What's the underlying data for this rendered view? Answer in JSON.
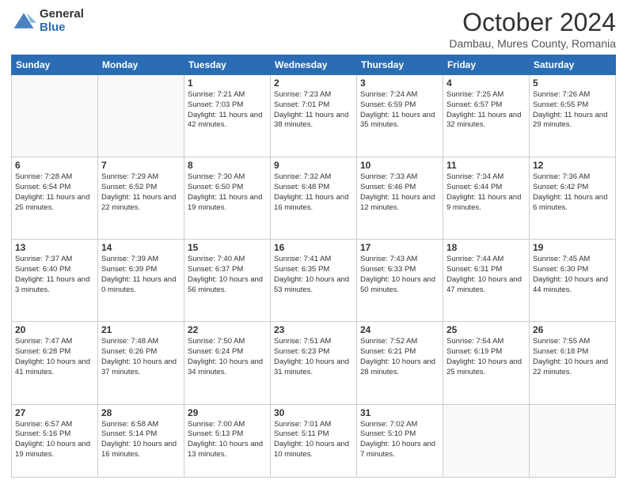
{
  "header": {
    "logo_general": "General",
    "logo_blue": "Blue",
    "month_title": "October 2024",
    "location": "Dambau, Mures County, Romania"
  },
  "weekdays": [
    "Sunday",
    "Monday",
    "Tuesday",
    "Wednesday",
    "Thursday",
    "Friday",
    "Saturday"
  ],
  "weeks": [
    [
      {
        "day": "",
        "sunrise": "",
        "sunset": "",
        "daylight": ""
      },
      {
        "day": "",
        "sunrise": "",
        "sunset": "",
        "daylight": ""
      },
      {
        "day": "1",
        "sunrise": "Sunrise: 7:21 AM",
        "sunset": "Sunset: 7:03 PM",
        "daylight": "Daylight: 11 hours and 42 minutes."
      },
      {
        "day": "2",
        "sunrise": "Sunrise: 7:23 AM",
        "sunset": "Sunset: 7:01 PM",
        "daylight": "Daylight: 11 hours and 38 minutes."
      },
      {
        "day": "3",
        "sunrise": "Sunrise: 7:24 AM",
        "sunset": "Sunset: 6:59 PM",
        "daylight": "Daylight: 11 hours and 35 minutes."
      },
      {
        "day": "4",
        "sunrise": "Sunrise: 7:25 AM",
        "sunset": "Sunset: 6:57 PM",
        "daylight": "Daylight: 11 hours and 32 minutes."
      },
      {
        "day": "5",
        "sunrise": "Sunrise: 7:26 AM",
        "sunset": "Sunset: 6:55 PM",
        "daylight": "Daylight: 11 hours and 29 minutes."
      }
    ],
    [
      {
        "day": "6",
        "sunrise": "Sunrise: 7:28 AM",
        "sunset": "Sunset: 6:54 PM",
        "daylight": "Daylight: 11 hours and 25 minutes."
      },
      {
        "day": "7",
        "sunrise": "Sunrise: 7:29 AM",
        "sunset": "Sunset: 6:52 PM",
        "daylight": "Daylight: 11 hours and 22 minutes."
      },
      {
        "day": "8",
        "sunrise": "Sunrise: 7:30 AM",
        "sunset": "Sunset: 6:50 PM",
        "daylight": "Daylight: 11 hours and 19 minutes."
      },
      {
        "day": "9",
        "sunrise": "Sunrise: 7:32 AM",
        "sunset": "Sunset: 6:48 PM",
        "daylight": "Daylight: 11 hours and 16 minutes."
      },
      {
        "day": "10",
        "sunrise": "Sunrise: 7:33 AM",
        "sunset": "Sunset: 6:46 PM",
        "daylight": "Daylight: 11 hours and 12 minutes."
      },
      {
        "day": "11",
        "sunrise": "Sunrise: 7:34 AM",
        "sunset": "Sunset: 6:44 PM",
        "daylight": "Daylight: 11 hours and 9 minutes."
      },
      {
        "day": "12",
        "sunrise": "Sunrise: 7:36 AM",
        "sunset": "Sunset: 6:42 PM",
        "daylight": "Daylight: 11 hours and 6 minutes."
      }
    ],
    [
      {
        "day": "13",
        "sunrise": "Sunrise: 7:37 AM",
        "sunset": "Sunset: 6:40 PM",
        "daylight": "Daylight: 11 hours and 3 minutes."
      },
      {
        "day": "14",
        "sunrise": "Sunrise: 7:39 AM",
        "sunset": "Sunset: 6:39 PM",
        "daylight": "Daylight: 11 hours and 0 minutes."
      },
      {
        "day": "15",
        "sunrise": "Sunrise: 7:40 AM",
        "sunset": "Sunset: 6:37 PM",
        "daylight": "Daylight: 10 hours and 56 minutes."
      },
      {
        "day": "16",
        "sunrise": "Sunrise: 7:41 AM",
        "sunset": "Sunset: 6:35 PM",
        "daylight": "Daylight: 10 hours and 53 minutes."
      },
      {
        "day": "17",
        "sunrise": "Sunrise: 7:43 AM",
        "sunset": "Sunset: 6:33 PM",
        "daylight": "Daylight: 10 hours and 50 minutes."
      },
      {
        "day": "18",
        "sunrise": "Sunrise: 7:44 AM",
        "sunset": "Sunset: 6:31 PM",
        "daylight": "Daylight: 10 hours and 47 minutes."
      },
      {
        "day": "19",
        "sunrise": "Sunrise: 7:45 AM",
        "sunset": "Sunset: 6:30 PM",
        "daylight": "Daylight: 10 hours and 44 minutes."
      }
    ],
    [
      {
        "day": "20",
        "sunrise": "Sunrise: 7:47 AM",
        "sunset": "Sunset: 6:28 PM",
        "daylight": "Daylight: 10 hours and 41 minutes."
      },
      {
        "day": "21",
        "sunrise": "Sunrise: 7:48 AM",
        "sunset": "Sunset: 6:26 PM",
        "daylight": "Daylight: 10 hours and 37 minutes."
      },
      {
        "day": "22",
        "sunrise": "Sunrise: 7:50 AM",
        "sunset": "Sunset: 6:24 PM",
        "daylight": "Daylight: 10 hours and 34 minutes."
      },
      {
        "day": "23",
        "sunrise": "Sunrise: 7:51 AM",
        "sunset": "Sunset: 6:23 PM",
        "daylight": "Daylight: 10 hours and 31 minutes."
      },
      {
        "day": "24",
        "sunrise": "Sunrise: 7:52 AM",
        "sunset": "Sunset: 6:21 PM",
        "daylight": "Daylight: 10 hours and 28 minutes."
      },
      {
        "day": "25",
        "sunrise": "Sunrise: 7:54 AM",
        "sunset": "Sunset: 6:19 PM",
        "daylight": "Daylight: 10 hours and 25 minutes."
      },
      {
        "day": "26",
        "sunrise": "Sunrise: 7:55 AM",
        "sunset": "Sunset: 6:18 PM",
        "daylight": "Daylight: 10 hours and 22 minutes."
      }
    ],
    [
      {
        "day": "27",
        "sunrise": "Sunrise: 6:57 AM",
        "sunset": "Sunset: 5:16 PM",
        "daylight": "Daylight: 10 hours and 19 minutes."
      },
      {
        "day": "28",
        "sunrise": "Sunrise: 6:58 AM",
        "sunset": "Sunset: 5:14 PM",
        "daylight": "Daylight: 10 hours and 16 minutes."
      },
      {
        "day": "29",
        "sunrise": "Sunrise: 7:00 AM",
        "sunset": "Sunset: 5:13 PM",
        "daylight": "Daylight: 10 hours and 13 minutes."
      },
      {
        "day": "30",
        "sunrise": "Sunrise: 7:01 AM",
        "sunset": "Sunset: 5:11 PM",
        "daylight": "Daylight: 10 hours and 10 minutes."
      },
      {
        "day": "31",
        "sunrise": "Sunrise: 7:02 AM",
        "sunset": "Sunset: 5:10 PM",
        "daylight": "Daylight: 10 hours and 7 minutes."
      },
      {
        "day": "",
        "sunrise": "",
        "sunset": "",
        "daylight": ""
      },
      {
        "day": "",
        "sunrise": "",
        "sunset": "",
        "daylight": ""
      }
    ]
  ]
}
